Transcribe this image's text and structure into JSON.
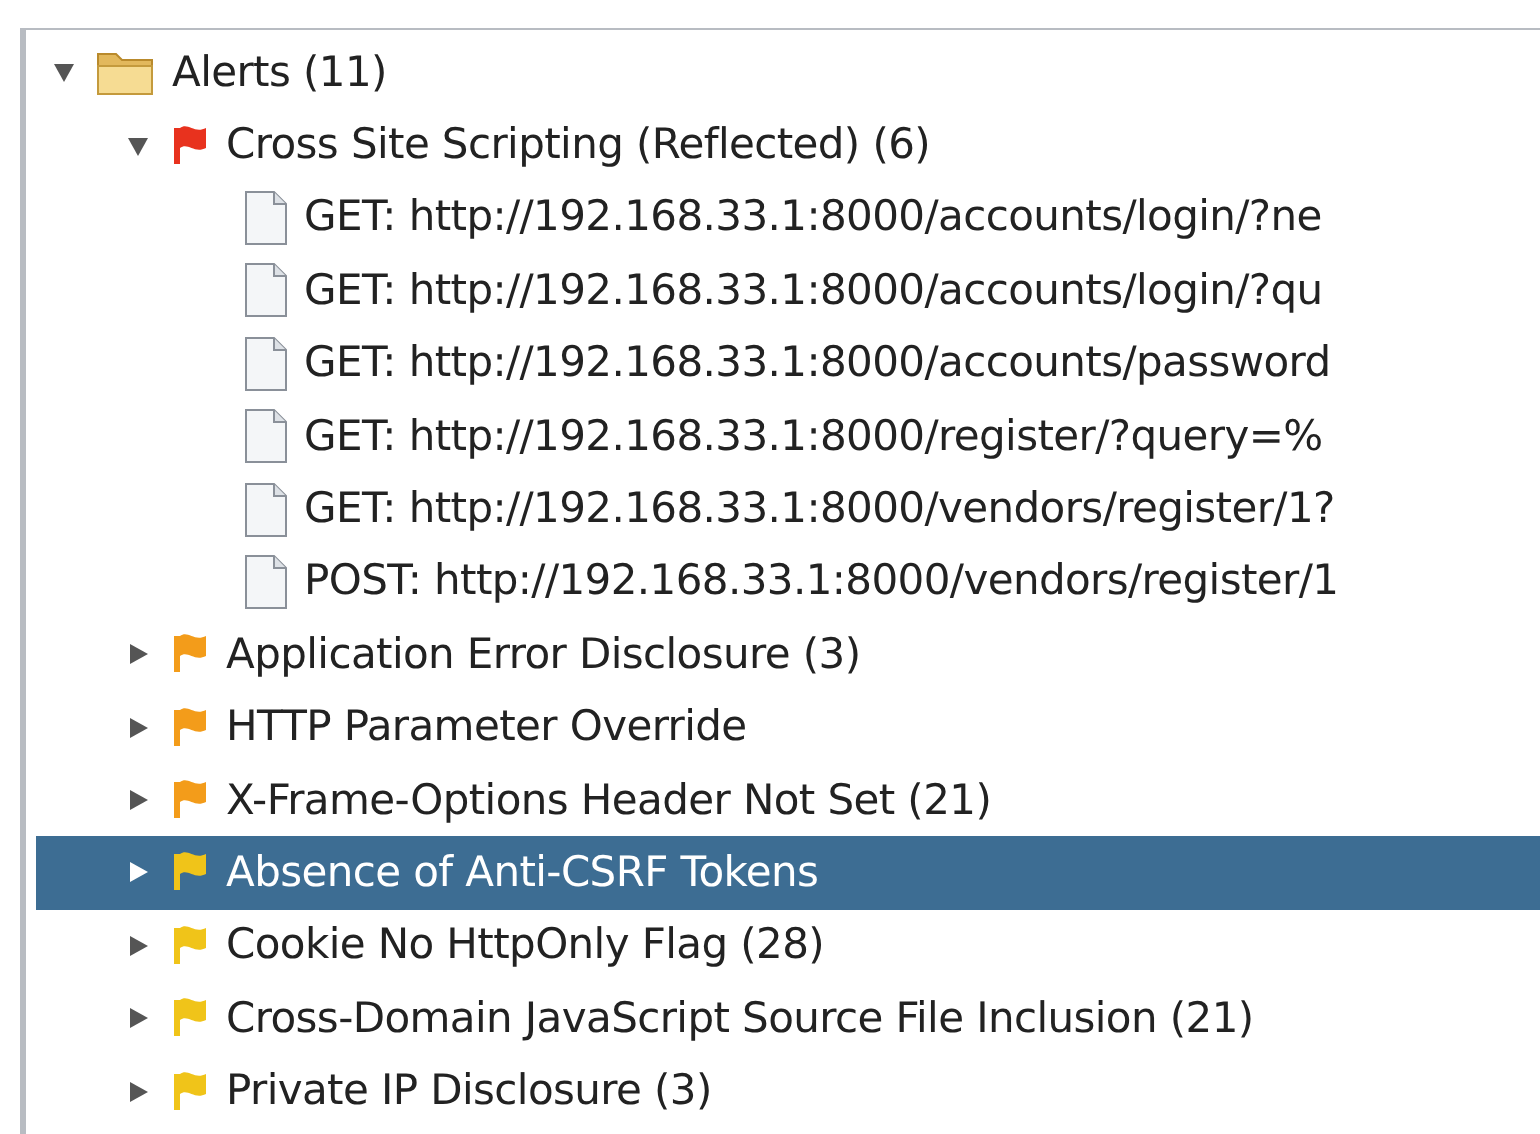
{
  "tree": {
    "label": "Alerts (11)",
    "kind": "folder",
    "expanded": true,
    "selected": false,
    "children": [
      {
        "label": "Cross Site Scripting (Reflected) (6)",
        "kind": "alert",
        "color": "#e8321e",
        "expanded": true,
        "selected": false,
        "children": [
          {
            "label": "GET: http://192.168.33.1:8000/accounts/login/?ne",
            "kind": "request",
            "selected": false
          },
          {
            "label": "GET: http://192.168.33.1:8000/accounts/login/?qu",
            "kind": "request",
            "selected": false
          },
          {
            "label": "GET: http://192.168.33.1:8000/accounts/password",
            "kind": "request",
            "selected": false
          },
          {
            "label": "GET: http://192.168.33.1:8000/register/?query=%",
            "kind": "request",
            "selected": false
          },
          {
            "label": "GET: http://192.168.33.1:8000/vendors/register/1?",
            "kind": "request",
            "selected": false
          },
          {
            "label": "POST: http://192.168.33.1:8000/vendors/register/1",
            "kind": "request",
            "selected": false
          }
        ]
      },
      {
        "label": "Application Error Disclosure (3)",
        "kind": "alert",
        "color": "#f39c1a",
        "expanded": false,
        "selected": false
      },
      {
        "label": "HTTP Parameter Override",
        "kind": "alert",
        "color": "#f39c1a",
        "expanded": false,
        "selected": false
      },
      {
        "label": "X-Frame-Options Header Not Set (21)",
        "kind": "alert",
        "color": "#f39c1a",
        "expanded": false,
        "selected": false
      },
      {
        "label": "Absence of Anti-CSRF Tokens",
        "kind": "alert",
        "color": "#f0c419",
        "expanded": false,
        "selected": true
      },
      {
        "label": "Cookie No HttpOnly Flag (28)",
        "kind": "alert",
        "color": "#f0c419",
        "expanded": false,
        "selected": false
      },
      {
        "label": "Cross-Domain JavaScript Source File Inclusion (21)",
        "kind": "alert",
        "color": "#f0c419",
        "expanded": false,
        "selected": false
      },
      {
        "label": "Private IP Disclosure (3)",
        "kind": "alert",
        "color": "#f0c419",
        "expanded": false,
        "selected": false
      }
    ]
  }
}
